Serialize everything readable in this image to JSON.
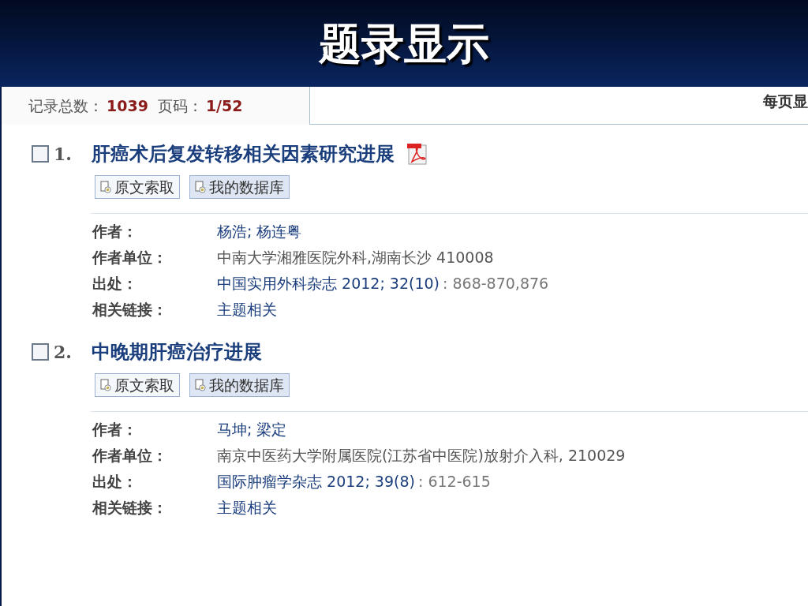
{
  "slide_title": "题录显示",
  "summary": {
    "total_label": "记录总数：",
    "total": "1039",
    "page_label": "页码：",
    "page": "1/52"
  },
  "per_page_label": "每页显",
  "records": [
    {
      "number": "1.",
      "checked": false,
      "title": "肝癌术后复发转移相关因素研究进展",
      "has_pdf": true,
      "buttons": [
        "原文索取",
        "我的数据库"
      ],
      "fields": [
        {
          "label": "作者：",
          "kind": "link",
          "value": "杨浩; 杨连粤"
        },
        {
          "label": "作者单位：",
          "kind": "plain",
          "value": "中南大学湘雅医院外科,湖南长沙  410008"
        },
        {
          "label": "出处：",
          "kind": "source",
          "value": "中国实用外科杂志 2012; 32(10)",
          "extra": ": 868-870,876"
        },
        {
          "label": "相关链接：",
          "kind": "link",
          "value": "主题相关"
        }
      ]
    },
    {
      "number": "2.",
      "checked": false,
      "title": "中晚期肝癌治疗进展",
      "has_pdf": false,
      "buttons": [
        "原文索取",
        "我的数据库"
      ],
      "fields": [
        {
          "label": "作者：",
          "kind": "link",
          "value": "马坤; 梁定"
        },
        {
          "label": "作者单位：",
          "kind": "plain",
          "value": "南京中医药大学附属医院(江苏省中医院)放射介入科, 210029"
        },
        {
          "label": "出处：",
          "kind": "source",
          "value": "国际肿瘤学杂志 2012; 39(8)",
          "extra": ": 612-615"
        },
        {
          "label": "相关链接：",
          "kind": "link",
          "value": "主题相关"
        }
      ]
    }
  ]
}
